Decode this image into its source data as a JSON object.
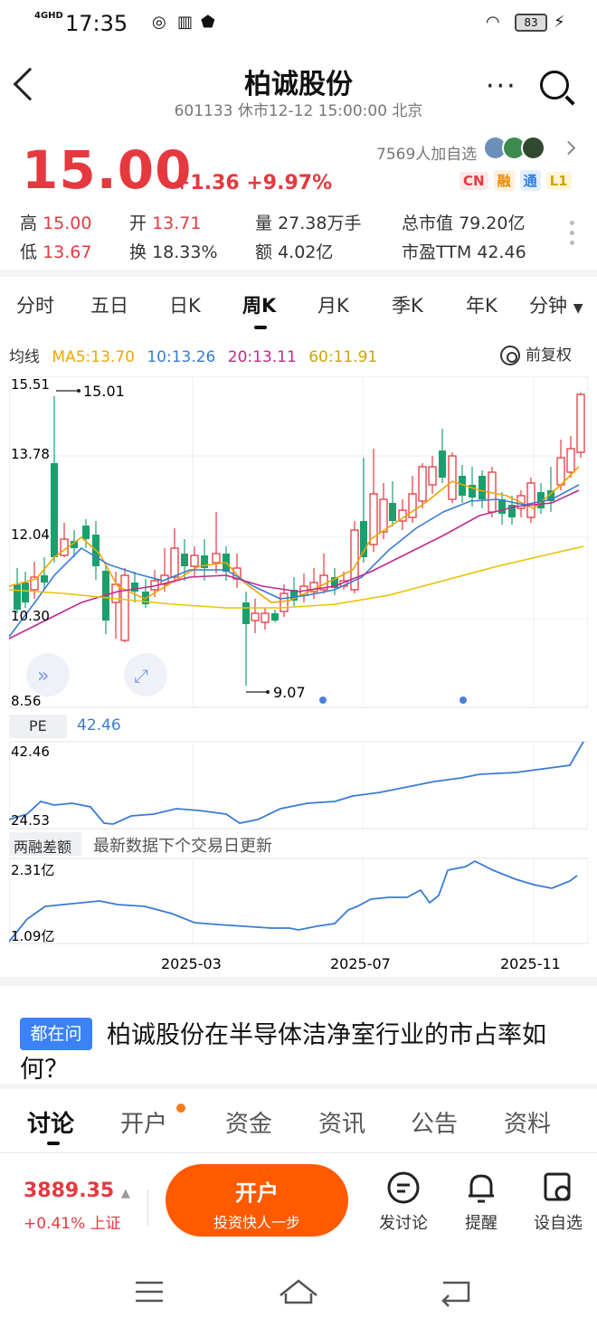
{
  "status_bar": {
    "network": "4GHD",
    "time": "17:35",
    "battery": "83"
  },
  "header": {
    "title": "柏诚股份",
    "subtitle": "601133 休市12-12 15:00:00 北京"
  },
  "quote": {
    "price": "15.00",
    "change": "+1.36 +9.97%",
    "followers": "7569人加自选",
    "tags": [
      "CN",
      "融",
      "通",
      "L1"
    ],
    "stats": [
      {
        "label": "高",
        "value": "15.00"
      },
      {
        "label": "开",
        "value": "13.71"
      },
      {
        "label": "量",
        "value": "27.38万手"
      },
      {
        "label": "总市值",
        "value": "79.20亿"
      },
      {
        "label": "低",
        "value": "13.67"
      },
      {
        "label": "换",
        "value": "18.33%"
      },
      {
        "label": "额",
        "value": "4.02亿"
      },
      {
        "label": "市盈TTM",
        "value": "42.46"
      }
    ]
  },
  "chart_tabs": [
    "分时",
    "五日",
    "日K",
    "周K",
    "月K",
    "季K",
    "年K",
    "分钟"
  ],
  "active_tab": "周K",
  "ma": {
    "label": "均线",
    "items": [
      {
        "text": "MA5:13.70",
        "color": "#f0a500"
      },
      {
        "text": "10:13.26",
        "color": "#3a7bd5"
      },
      {
        "text": "20:13.11",
        "color": "#c02a8c"
      },
      {
        "text": "60:11.91",
        "color": "#e8c300"
      }
    ],
    "adjust": "前复权"
  },
  "kline": {
    "y_labels": [
      "15.51",
      "13.78",
      "12.04",
      "10.30",
      "8.56"
    ],
    "max_label": "15.01",
    "min_label": "9.07"
  },
  "pe": {
    "label": "PE",
    "value": "42.46",
    "y_labels": [
      "42.46",
      "24.53"
    ]
  },
  "margin": {
    "label": "两融差额",
    "note": "最新数据下个交易日更新",
    "y_labels": [
      "2.31亿",
      "1.09亿"
    ]
  },
  "dates": [
    "2025-03",
    "2025-07",
    "2025-11"
  ],
  "question": {
    "badge": "都在问",
    "text": "柏诚股份在半导体洁净室行业的市占率如何？"
  },
  "bottom_tabs": [
    "讨论",
    "开户",
    "资金",
    "资讯",
    "公告",
    "资料"
  ],
  "footer": {
    "index_value": "3889.35",
    "index_change": "+0.41% 上证",
    "open_main": "开户",
    "open_sub": "投资快人一步",
    "actions": [
      "发讨论",
      "提醒",
      "设自选"
    ]
  }
}
